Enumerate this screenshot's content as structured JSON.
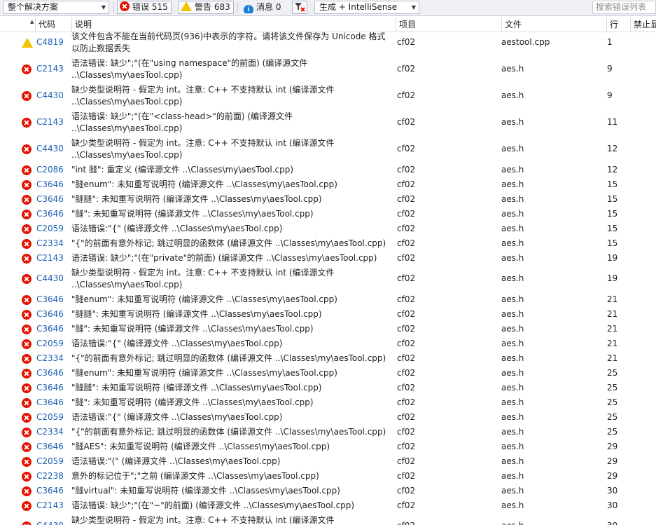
{
  "toolbar": {
    "scope_combo": "整个解决方案",
    "errors_label": "错误 515",
    "warnings_label": "警告 683",
    "messages_label": "消息 0",
    "build_combo": "生成 + IntelliSense",
    "search_placeholder": "搜索错误列表"
  },
  "columns": {
    "code": "代码",
    "description": "说明",
    "project": "项目",
    "file": "文件",
    "line": "行",
    "suppress": "禁止显"
  },
  "rows": [
    {
      "type": "warning",
      "code": "C4819",
      "desc": "该文件包含不能在当前代码页(936)中表示的字符。请将该文件保存为 Unicode 格式以防止数据丢失",
      "project": "cf02",
      "file": "aestool.cpp",
      "line": "1"
    },
    {
      "type": "error",
      "code": "C2143",
      "desc": "语法错误: 缺少\";\"(在\"using namespace\"的前面) (编译源文件 ..\\Classes\\my\\aesTool.cpp)",
      "project": "cf02",
      "file": "aes.h",
      "line": "9"
    },
    {
      "type": "error",
      "code": "C4430",
      "desc": "缺少类型说明符 - 假定为 int。注意: C++ 不支持默认 int (编译源文件 ..\\Classes\\my\\aesTool.cpp)",
      "project": "cf02",
      "file": "aes.h",
      "line": "9"
    },
    {
      "type": "error",
      "code": "C2143",
      "desc": "语法错误: 缺少\";\"(在\"<class-head>\"的前面) (编译源文件 ..\\Classes\\my\\aesTool.cpp)",
      "project": "cf02",
      "file": "aes.h",
      "line": "11"
    },
    {
      "type": "error",
      "code": "C4430",
      "desc": "缺少类型说明符 - 假定为 int。注意: C++ 不支持默认 int (编译源文件 ..\\Classes\\my\\aesTool.cpp)",
      "project": "cf02",
      "file": "aes.h",
      "line": "12"
    },
    {
      "type": "error",
      "code": "C2086",
      "desc": "\"int 膖\": 重定义 (编译源文件 ..\\Classes\\my\\aesTool.cpp)",
      "project": "cf02",
      "file": "aes.h",
      "line": "12"
    },
    {
      "type": "error",
      "code": "C3646",
      "desc": "\"膖enum\": 未知重写说明符 (编译源文件 ..\\Classes\\my\\aesTool.cpp)",
      "project": "cf02",
      "file": "aes.h",
      "line": "15"
    },
    {
      "type": "error",
      "code": "C3646",
      "desc": "\"膖膖\": 未知重写说明符 (编译源文件 ..\\Classes\\my\\aesTool.cpp)",
      "project": "cf02",
      "file": "aes.h",
      "line": "15"
    },
    {
      "type": "error",
      "code": "C3646",
      "desc": "\"膖\": 未知重写说明符 (编译源文件 ..\\Classes\\my\\aesTool.cpp)",
      "project": "cf02",
      "file": "aes.h",
      "line": "15"
    },
    {
      "type": "error",
      "code": "C2059",
      "desc": "语法错误:\"{\" (编译源文件 ..\\Classes\\my\\aesTool.cpp)",
      "project": "cf02",
      "file": "aes.h",
      "line": "15"
    },
    {
      "type": "error",
      "code": "C2334",
      "desc": "\"{\"的前面有意外标记; 跳过明显的函数体 (编译源文件 ..\\Classes\\my\\aesTool.cpp)",
      "project": "cf02",
      "file": "aes.h",
      "line": "15"
    },
    {
      "type": "error",
      "code": "C2143",
      "desc": "语法错误: 缺少\";\"(在\"private\"的前面) (编译源文件 ..\\Classes\\my\\aesTool.cpp)",
      "project": "cf02",
      "file": "aes.h",
      "line": "19"
    },
    {
      "type": "error",
      "code": "C4430",
      "desc": "缺少类型说明符 - 假定为 int。注意: C++ 不支持默认 int (编译源文件 ..\\Classes\\my\\aesTool.cpp)",
      "project": "cf02",
      "file": "aes.h",
      "line": "19"
    },
    {
      "type": "error",
      "code": "C3646",
      "desc": "\"膖enum\": 未知重写说明符 (编译源文件 ..\\Classes\\my\\aesTool.cpp)",
      "project": "cf02",
      "file": "aes.h",
      "line": "21"
    },
    {
      "type": "error",
      "code": "C3646",
      "desc": "\"膖膖\": 未知重写说明符 (编译源文件 ..\\Classes\\my\\aesTool.cpp)",
      "project": "cf02",
      "file": "aes.h",
      "line": "21"
    },
    {
      "type": "error",
      "code": "C3646",
      "desc": "\"膖\": 未知重写说明符 (编译源文件 ..\\Classes\\my\\aesTool.cpp)",
      "project": "cf02",
      "file": "aes.h",
      "line": "21"
    },
    {
      "type": "error",
      "code": "C2059",
      "desc": "语法错误:\"{\" (编译源文件 ..\\Classes\\my\\aesTool.cpp)",
      "project": "cf02",
      "file": "aes.h",
      "line": "21"
    },
    {
      "type": "error",
      "code": "C2334",
      "desc": "\"{\"的前面有意外标记; 跳过明显的函数体 (编译源文件 ..\\Classes\\my\\aesTool.cpp)",
      "project": "cf02",
      "file": "aes.h",
      "line": "21"
    },
    {
      "type": "error",
      "code": "C3646",
      "desc": "\"膖enum\": 未知重写说明符 (编译源文件 ..\\Classes\\my\\aesTool.cpp)",
      "project": "cf02",
      "file": "aes.h",
      "line": "25"
    },
    {
      "type": "error",
      "code": "C3646",
      "desc": "\"膖膖\": 未知重写说明符 (编译源文件 ..\\Classes\\my\\aesTool.cpp)",
      "project": "cf02",
      "file": "aes.h",
      "line": "25"
    },
    {
      "type": "error",
      "code": "C3646",
      "desc": "\"膖\": 未知重写说明符 (编译源文件 ..\\Classes\\my\\aesTool.cpp)",
      "project": "cf02",
      "file": "aes.h",
      "line": "25"
    },
    {
      "type": "error",
      "code": "C2059",
      "desc": "语法错误:\"{\" (编译源文件 ..\\Classes\\my\\aesTool.cpp)",
      "project": "cf02",
      "file": "aes.h",
      "line": "25"
    },
    {
      "type": "error",
      "code": "C2334",
      "desc": "\"{\"的前面有意外标记; 跳过明显的函数体 (编译源文件 ..\\Classes\\my\\aesTool.cpp)",
      "project": "cf02",
      "file": "aes.h",
      "line": "25"
    },
    {
      "type": "error",
      "code": "C3646",
      "desc": "\"膖AES\": 未知重写说明符 (编译源文件 ..\\Classes\\my\\aesTool.cpp)",
      "project": "cf02",
      "file": "aes.h",
      "line": "29"
    },
    {
      "type": "error",
      "code": "C2059",
      "desc": "语法错误:\"(\" (编译源文件 ..\\Classes\\my\\aesTool.cpp)",
      "project": "cf02",
      "file": "aes.h",
      "line": "29"
    },
    {
      "type": "error",
      "code": "C2238",
      "desc": "意外的标记位于\";\"之前 (编译源文件 ..\\Classes\\my\\aesTool.cpp)",
      "project": "cf02",
      "file": "aes.h",
      "line": "29"
    },
    {
      "type": "error",
      "code": "C3646",
      "desc": "\"膖virtual\": 未知重写说明符 (编译源文件 ..\\Classes\\my\\aesTool.cpp)",
      "project": "cf02",
      "file": "aes.h",
      "line": "30"
    },
    {
      "type": "error",
      "code": "C2143",
      "desc": "语法错误: 缺少\";\"(在\"~\"的前面) (编译源文件 ..\\Classes\\my\\aesTool.cpp)",
      "project": "cf02",
      "file": "aes.h",
      "line": "30"
    },
    {
      "type": "error",
      "code": "C4430",
      "desc": "缺少类型说明符 - 假定为 int。注意: C++ 不支持默认 int (编译源文件 ..\\Classes\\my\\aesTool.cpp)",
      "project": "cf02",
      "file": "aes.h",
      "line": "30"
    }
  ]
}
